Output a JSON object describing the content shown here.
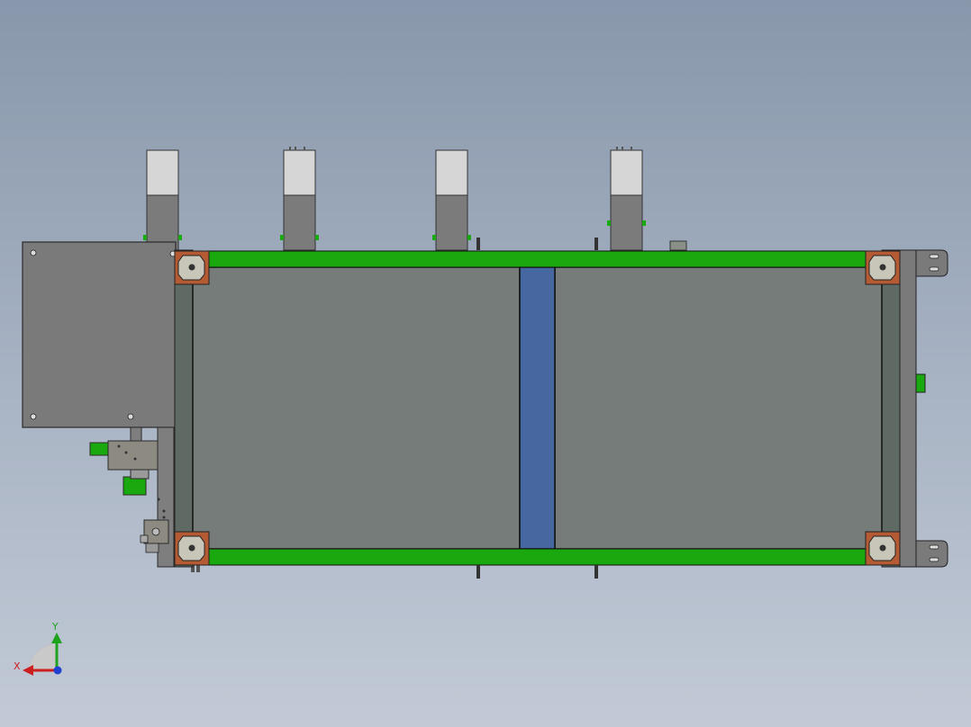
{
  "viewport": {
    "background_top": "#8897ab",
    "background_bottom": "#c2cad6"
  },
  "model": {
    "frame_color": "#1aa80f",
    "panel_color": "#767c79",
    "divider_color": "#4767a0",
    "corner_block_color": "#b45b34",
    "housing_color": "#7a7a7a"
  },
  "triad": {
    "x_label": "X",
    "y_label": "Y",
    "x_color": "#cc1f1f",
    "y_color": "#1fa31f",
    "z_color": "#2040d0",
    "x_icon": "x-axis-arrow-icon",
    "y_icon": "y-axis-arrow-icon"
  }
}
